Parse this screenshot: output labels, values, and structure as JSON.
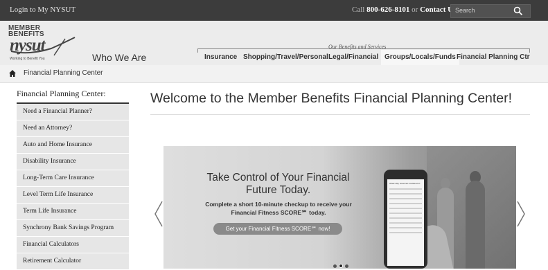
{
  "topbar": {
    "login_label": "Login to My NYSUT",
    "call_prefix": "Call",
    "phone": "800-626-8101",
    "or_text": "or",
    "contact_label": "Contact Us",
    "search_placeholder": "Search",
    "search_icon": "magnifier-icon"
  },
  "logo": {
    "line1": "MEMBER",
    "line2": "BENEFITS",
    "wordmark": "nysut",
    "tagline": "Working to Benefit You"
  },
  "header": {
    "section_title": "Who We Are",
    "nav_caption": "Our Benefits and Services",
    "nav": [
      {
        "label": "Insurance"
      },
      {
        "label": "Shopping/Travel/Personal"
      },
      {
        "label": "Legal/Financial"
      },
      {
        "label": "Groups/Locals/Funds"
      },
      {
        "label": "Financial Planning Ctr"
      }
    ]
  },
  "breadcrumb": {
    "home_icon": "home-icon",
    "current": "Financial Planning Center"
  },
  "sidebar": {
    "title": "Financial Planning Center:",
    "items": [
      {
        "label": "Need a Financial Planner?"
      },
      {
        "label": "Need an Attorney?"
      },
      {
        "label": "Auto and Home Insurance"
      },
      {
        "label": "Disability Insurance"
      },
      {
        "label": "Long-Term Care Insurance"
      },
      {
        "label": "Level Term Life Insurance"
      },
      {
        "label": "Term Life Insurance"
      },
      {
        "label": "Synchrony Bank Savings Program"
      },
      {
        "label": "Financial Calculators"
      },
      {
        "label": "Retirement Calculator"
      }
    ]
  },
  "main": {
    "heading": "Welcome to the Member Benefits Financial Planning Center!"
  },
  "slide": {
    "title": "Take Control of Your Financial Future Today.",
    "body": "Complete a short 10-minute checkup to receive your Financial Fitness SCORE℠ today.",
    "cta": "Get your Financial Fitness SCORE℠ now!",
    "phone_heading": "What's My Financial Confidence?",
    "slide_count": 3,
    "active_slide": 2,
    "prev_icon": "chevron-left-icon",
    "next_icon": "chevron-right-icon"
  }
}
